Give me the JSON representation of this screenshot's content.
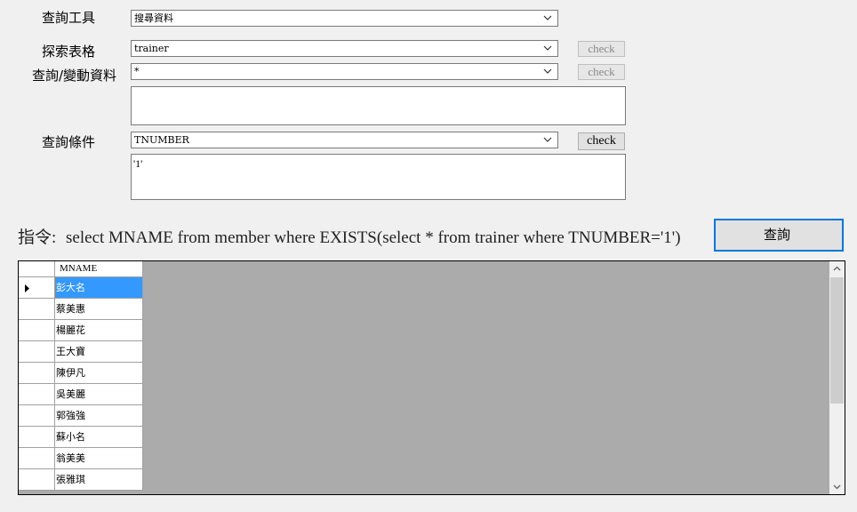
{
  "form": {
    "tool_label": "查詢工具",
    "tool_value": "搜尋資料",
    "table_label": "探索表格",
    "table_value": "trainer",
    "table_check": "check",
    "columns_label": "查詢/變動資料",
    "columns_value": "*",
    "columns_check": "check",
    "columns_text": "",
    "condition_label": "查詢條件",
    "condition_value": "TNUMBER",
    "condition_check": "check",
    "condition_text": "'1'"
  },
  "command": {
    "label": "指令:",
    "sql": "select MNAME from member where EXISTS(select * from trainer where TNUMBER='1')",
    "query_button": "查詢"
  },
  "grid": {
    "columns": [
      "MNAME"
    ],
    "rows": [
      "彭大名",
      "蔡美惠",
      "楊麗花",
      "王大寶",
      "陳伊凡",
      "吳美麗",
      "郭強強",
      "蘇小名",
      "翁美美",
      "張雅琪"
    ],
    "selected_row": 0
  }
}
